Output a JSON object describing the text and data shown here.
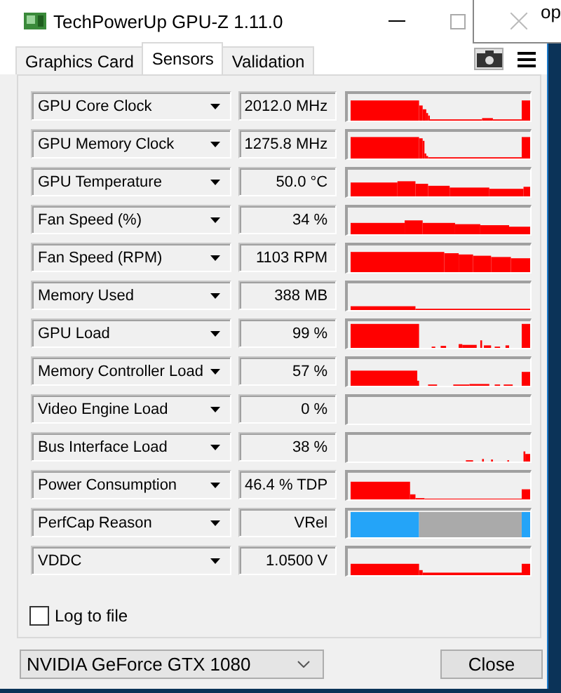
{
  "window": {
    "title": "TechPowerUp GPU-Z 1.11.0"
  },
  "background_text": "op",
  "tabs": [
    {
      "label": "Graphics Card",
      "selected": false
    },
    {
      "label": "Sensors",
      "selected": true
    },
    {
      "label": "Validation",
      "selected": false
    }
  ],
  "sensors": [
    {
      "name": "GPU Core Clock",
      "value": "2012.0 MHz",
      "kind": "graph"
    },
    {
      "name": "GPU Memory Clock",
      "value": "1275.8 MHz",
      "kind": "graph"
    },
    {
      "name": "GPU Temperature",
      "value": "50.0 °C",
      "kind": "graph"
    },
    {
      "name": "Fan Speed (%)",
      "value": "34 %",
      "kind": "graph"
    },
    {
      "name": "Fan Speed (RPM)",
      "value": "1103 RPM",
      "kind": "graph"
    },
    {
      "name": "Memory Used",
      "value": "388 MB",
      "kind": "graph"
    },
    {
      "name": "GPU Load",
      "value": "99 %",
      "kind": "graph"
    },
    {
      "name": "Memory Controller Load",
      "value": "57 %",
      "kind": "graph"
    },
    {
      "name": "Video Engine Load",
      "value": "0 %",
      "kind": "graph"
    },
    {
      "name": "Bus Interface Load",
      "value": "38 %",
      "kind": "graph"
    },
    {
      "name": "Power Consumption",
      "value": "46.4 % TDP",
      "kind": "graph"
    },
    {
      "name": "PerfCap Reason",
      "value": "VRel",
      "kind": "perfcap"
    },
    {
      "name": "VDDC",
      "value": "1.0500 V",
      "kind": "graph"
    }
  ],
  "log_to_file": {
    "label": "Log to file",
    "checked": false
  },
  "gpu_select": {
    "value": "NVIDIA GeForce GTX 1080"
  },
  "buttons": [
    "Close"
  ]
}
